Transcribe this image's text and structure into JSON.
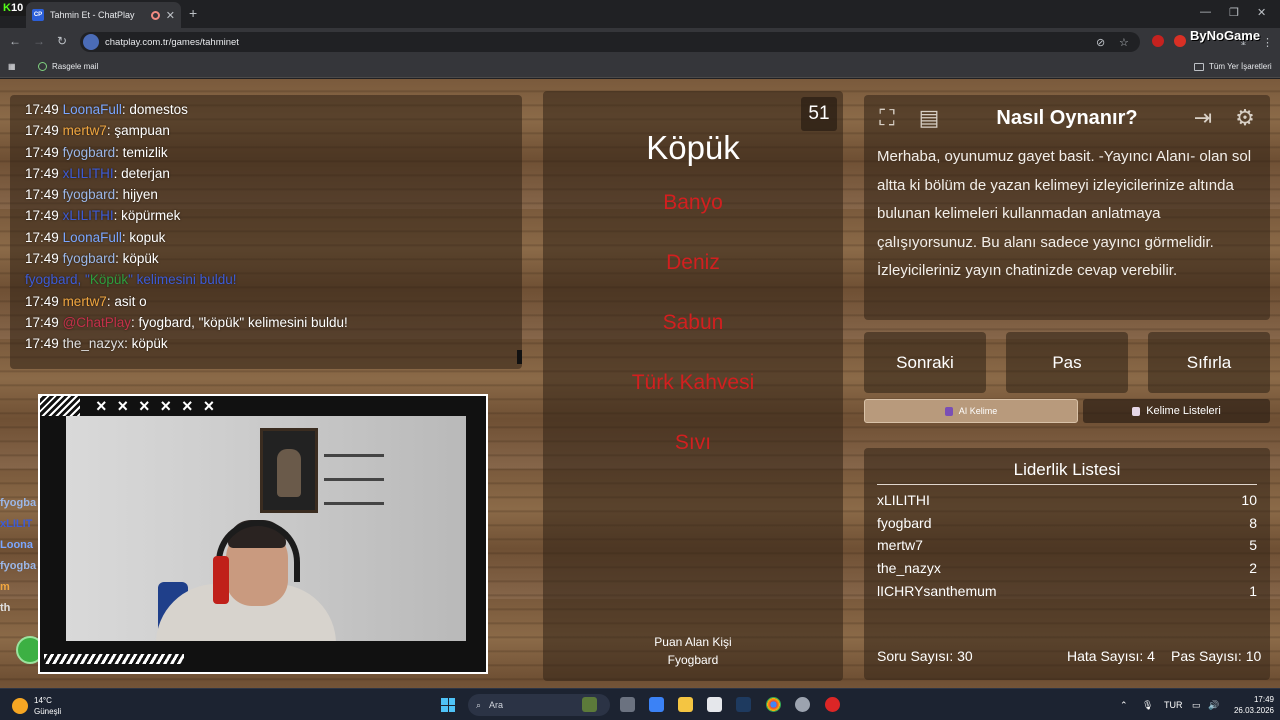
{
  "browser": {
    "tab_title": "Tahmin Et - ChatPlay",
    "tab_favicon": "CP",
    "url": "chatplay.com.tr/games/tahminet",
    "bookmark_1": "Rasgele mail",
    "bookmarks_all": "Tüm Yer İşaretleri",
    "overlay_k": "K",
    "overlay_num": "10",
    "overlay_brand": "ByNoGame"
  },
  "chat": {
    "messages": [
      {
        "time": "17:49",
        "user": "LoonaFull",
        "user_color": "#7aa6ff",
        "text": ": domestos"
      },
      {
        "time": "17:49",
        "user": "mertw7",
        "user_color": "#f0a640",
        "text": ": şampuan"
      },
      {
        "time": "17:49",
        "user": "fyogbard",
        "user_color": "#9bb7e8",
        "text": ": temizlik"
      },
      {
        "time": "17:49",
        "user": "xLILITHI",
        "user_color": "#3d5bd6",
        "text": ": deterjan"
      },
      {
        "time": "17:49",
        "user": "fyogbard",
        "user_color": "#9bb7e8",
        "text": ": hijyen"
      },
      {
        "time": "17:49",
        "user": "xLILITHI",
        "user_color": "#3d5bd6",
        "text": ": köpürmek"
      },
      {
        "time": "17:49",
        "user": "LoonaFull",
        "user_color": "#7aa6ff",
        "text": ": kopuk"
      },
      {
        "time": "17:49",
        "user": "fyogbard",
        "user_color": "#9bb7e8",
        "text": ": köpük"
      },
      {
        "time": "17:49",
        "user": "mertw7",
        "user_color": "#f0a640",
        "text": ": asit o"
      },
      {
        "time": "17:49",
        "user": "@ChatPlay",
        "user_color": "#c4304a",
        "text": ": fyogbard, \"köpük\" kelimesini buldu!"
      },
      {
        "time": "17:49",
        "user": "the_nazyx",
        "user_color": "#e0e0e0",
        "text": ": köpük"
      }
    ],
    "system_line": {
      "prefix": "fyogbard, \"",
      "word": "Köpük",
      "suffix": "\" kelimesini buldu!"
    }
  },
  "side_names": [
    {
      "text": "fyogba",
      "color": "#9bb7e8"
    },
    {
      "text": "xLILIT",
      "color": "#3d5bd6"
    },
    {
      "text": "Loona",
      "color": "#7aa6ff"
    },
    {
      "text": "fyogba",
      "color": "#9bb7e8"
    },
    {
      "text": "m",
      "color": "#f0a640"
    },
    {
      "text": "th",
      "color": "#e0e0e0"
    }
  ],
  "webcam": {
    "marks": "× × × × × ×"
  },
  "game": {
    "word": "Köpük",
    "taboo": [
      "Banyo",
      "Deniz",
      "Sabun",
      "Türk Kahvesi",
      "Sıvı"
    ],
    "countdown": "51",
    "scorer_label": "Puan Alan Kişi",
    "scorer_name": "Fyogbard"
  },
  "howto": {
    "title": "Nasıl Oynanır?",
    "text": "Merhaba, oyunumuz gayet basit. -Yayıncı Alanı- olan sol altta ki bölüm de yazan kelimeyi izleyicilerinize altında bulunan kelimeleri kullanmadan anlatmaya çalışıyorsunuz. Bu alanı sadece yayıncı görmelidir. İzleyicileriniz yayın chatinizde cevap verebilir."
  },
  "buttons": {
    "next": "Sonraki",
    "pass": "Pas",
    "reset": "Sıfırla",
    "ai_word": "AI Kelime",
    "word_lists": "Kelime Listeleri"
  },
  "leaderboard": {
    "title": "Liderlik Listesi",
    "rows": [
      {
        "name": "xLILITHI",
        "score": "10"
      },
      {
        "name": "fyogbard",
        "score": "8"
      },
      {
        "name": "mertw7",
        "score": "5"
      },
      {
        "name": "the_nazyx",
        "score": "2"
      },
      {
        "name": "lICHRYsanthemum",
        "score": "1"
      }
    ],
    "questions": "Soru Sayısı: 30",
    "errors": "Hata Sayısı: 4",
    "passes": "Pas Sayısı: 10"
  },
  "taskbar": {
    "temp": "14°C",
    "weather": "Güneşli",
    "search": "Ara",
    "lang": "TUR",
    "time": "17:49",
    "date": "26.03.2026"
  }
}
